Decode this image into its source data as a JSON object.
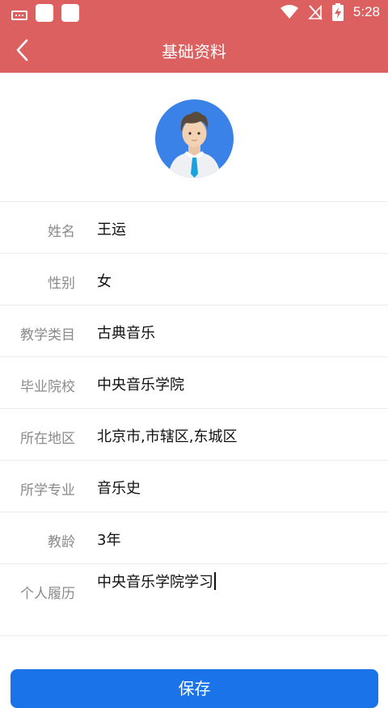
{
  "status_bar": {
    "time": "5:28",
    "icons": [
      "keyboard-icon",
      "app-icon",
      "app-icon",
      "wifi-icon",
      "no-signal-icon",
      "battery-charging-icon"
    ]
  },
  "header": {
    "title": "基础资料",
    "back_icon": "chevron-left-icon",
    "background_color": "#dc6060"
  },
  "avatar": {
    "icon": "user-avatar-icon"
  },
  "form": {
    "rows": [
      {
        "label": "姓名",
        "value": "王运"
      },
      {
        "label": "性别",
        "value": "女"
      },
      {
        "label": "教学类目",
        "value": "古典音乐"
      },
      {
        "label": "毕业院校",
        "value": "中央音乐学院"
      },
      {
        "label": "所在地区",
        "value": "北京市,市辖区,东城区"
      },
      {
        "label": "所学专业",
        "value": "音乐史"
      },
      {
        "label": "教龄",
        "value": "3年"
      }
    ],
    "resume": {
      "label": "个人履历",
      "value": "中央音乐学院学习"
    }
  },
  "save_button": {
    "label": "保存",
    "color": "#1a73e8"
  }
}
